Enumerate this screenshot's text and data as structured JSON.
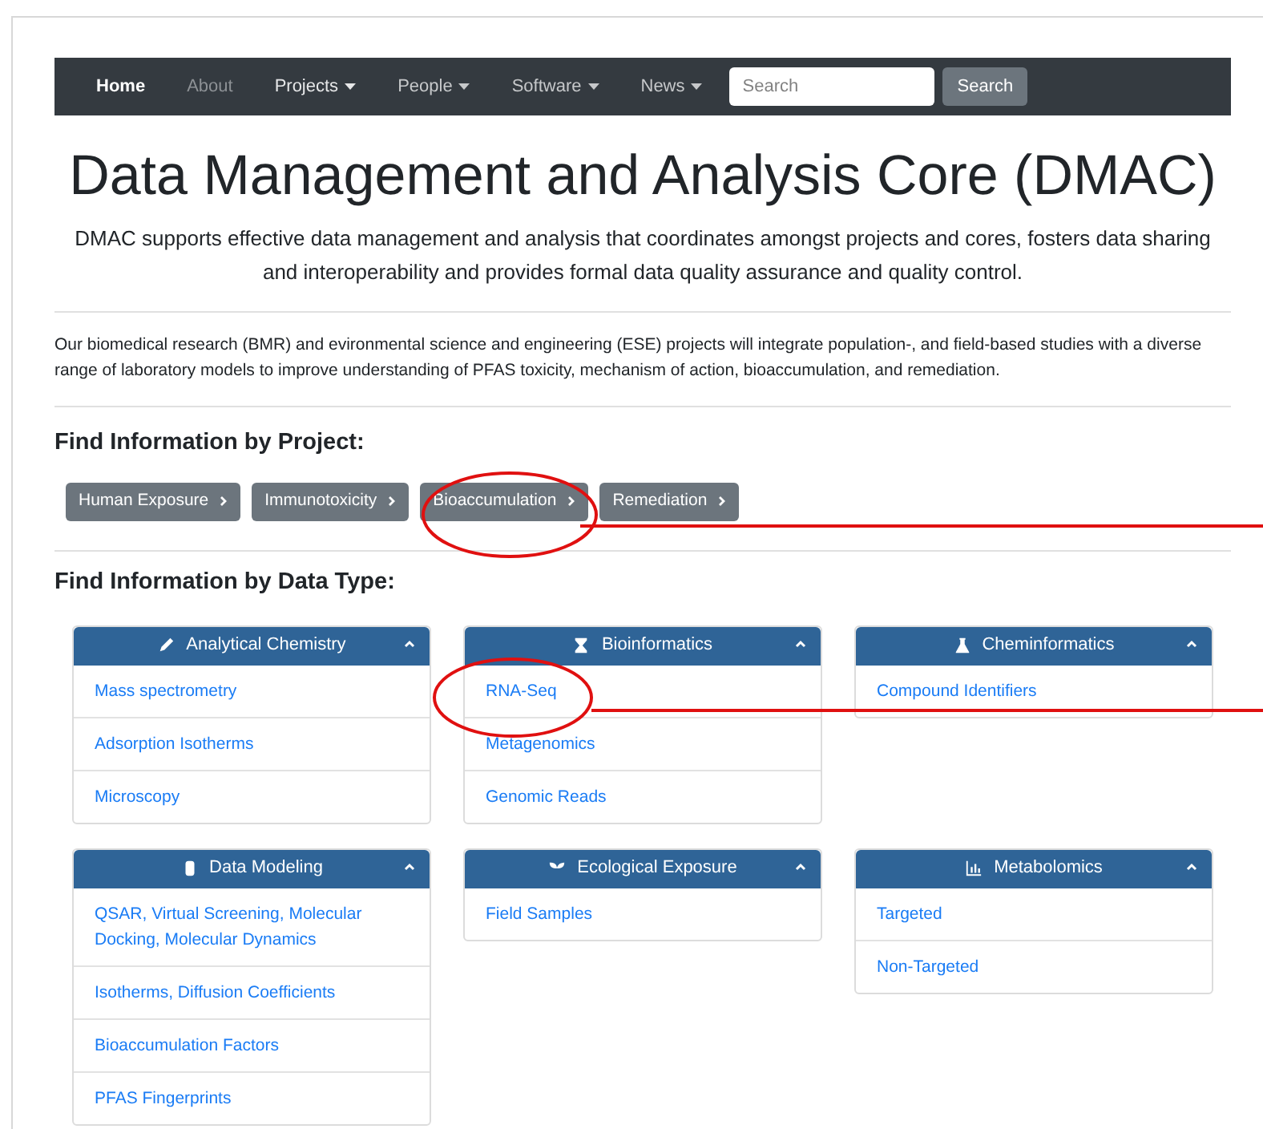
{
  "navbar": {
    "items": [
      {
        "label": "Home",
        "selected": true,
        "dropdown": false
      },
      {
        "label": "About",
        "selected": false,
        "dropdown": false
      },
      {
        "label": "Projects",
        "selected": false,
        "dropdown": true
      },
      {
        "label": "People",
        "selected": false,
        "dropdown": true
      },
      {
        "label": "Software",
        "selected": false,
        "dropdown": true
      },
      {
        "label": "News",
        "selected": false,
        "dropdown": true
      }
    ],
    "search": {
      "placeholder": "Search",
      "button": "Search"
    }
  },
  "header": {
    "title": "Data Management and Analysis Core (DMAC)",
    "subtitle": "DMAC supports effective data management and analysis that coordinates amongst projects and cores, fosters data sharing and interoperability and provides formal data quality assurance and quality control."
  },
  "intro": "Our biomedical research (BMR) and evironmental science and engineering (ESE) projects will integrate population-, and field-based studies with a diverse range of laboratory models to improve understanding of PFAS toxicity, mechanism of action, bioaccumulation, and remediation.",
  "projects": {
    "heading": "Find Information by Project:",
    "buttons": [
      "Human Exposure",
      "Immunotoxicity",
      "Bioaccumulation",
      "Remediation"
    ]
  },
  "data_types": {
    "heading": "Find Information by Data Type:",
    "cards": [
      {
        "title": "Analytical Chemistry",
        "expanded": true,
        "items": [
          "Mass spectrometry",
          "Adsorption Isotherms",
          "Microscopy"
        ]
      },
      {
        "title": "Bioinformatics",
        "expanded": true,
        "items": [
          "RNA-Seq",
          "Metagenomics",
          "Genomic Reads"
        ]
      },
      {
        "title": "Cheminformatics",
        "expanded": true,
        "items": [
          "Compound Identifiers"
        ]
      },
      {
        "title": "Data Modeling",
        "expanded": true,
        "items": [
          "QSAR, Virtual Screening, Molecular Docking, Molecular Dynamics",
          "Isotherms, Diffusion Coefficients",
          "Bioaccumulation Factors",
          "PFAS Fingerprints"
        ]
      },
      {
        "title": "Ecological Exposure",
        "expanded": true,
        "items": [
          "Field Samples"
        ]
      },
      {
        "title": "Metabolomics",
        "expanded": true,
        "items": [
          "Targeted",
          "Non-Targeted"
        ]
      }
    ]
  }
}
